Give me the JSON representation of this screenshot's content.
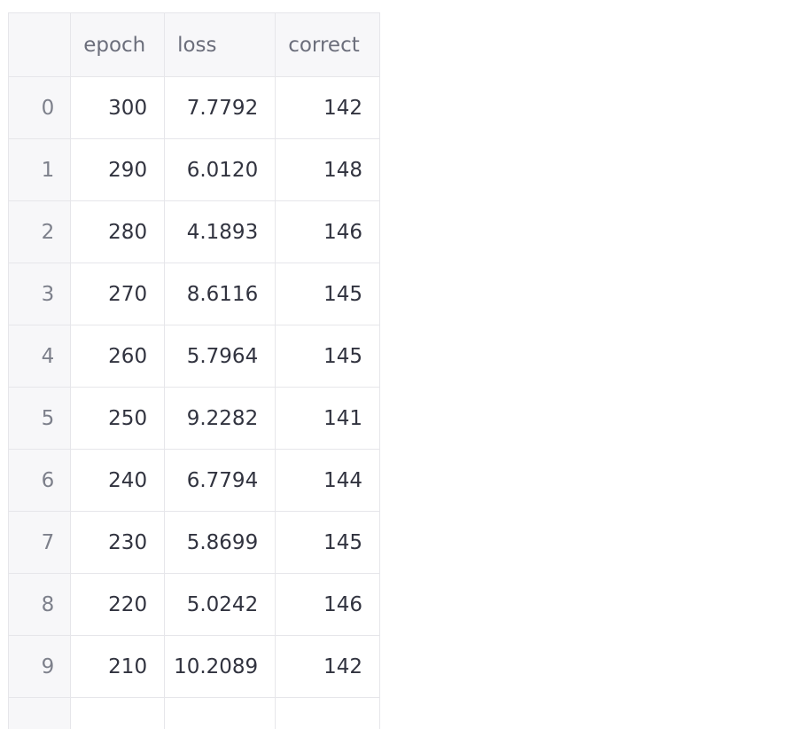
{
  "table": {
    "columns": [
      "",
      "epoch",
      "loss",
      "correct"
    ],
    "rows": [
      {
        "index": "0",
        "epoch": "300",
        "loss": "7.7792",
        "correct": "142"
      },
      {
        "index": "1",
        "epoch": "290",
        "loss": "6.0120",
        "correct": "148"
      },
      {
        "index": "2",
        "epoch": "280",
        "loss": "4.1893",
        "correct": "146"
      },
      {
        "index": "3",
        "epoch": "270",
        "loss": "8.6116",
        "correct": "145"
      },
      {
        "index": "4",
        "epoch": "260",
        "loss": "5.7964",
        "correct": "145"
      },
      {
        "index": "5",
        "epoch": "250",
        "loss": "9.2282",
        "correct": "141"
      },
      {
        "index": "6",
        "epoch": "240",
        "loss": "6.7794",
        "correct": "144"
      },
      {
        "index": "7",
        "epoch": "230",
        "loss": "5.8699",
        "correct": "145"
      },
      {
        "index": "8",
        "epoch": "220",
        "loss": "5.0242",
        "correct": "146"
      },
      {
        "index": "9",
        "epoch": "210",
        "loss": "10.2089",
        "correct": "142"
      }
    ]
  },
  "colors": {
    "header_bg": "#f7f7f9",
    "grid": "#e6e6ea",
    "text": "#31333f",
    "muted_text": "#6b6e7b"
  }
}
